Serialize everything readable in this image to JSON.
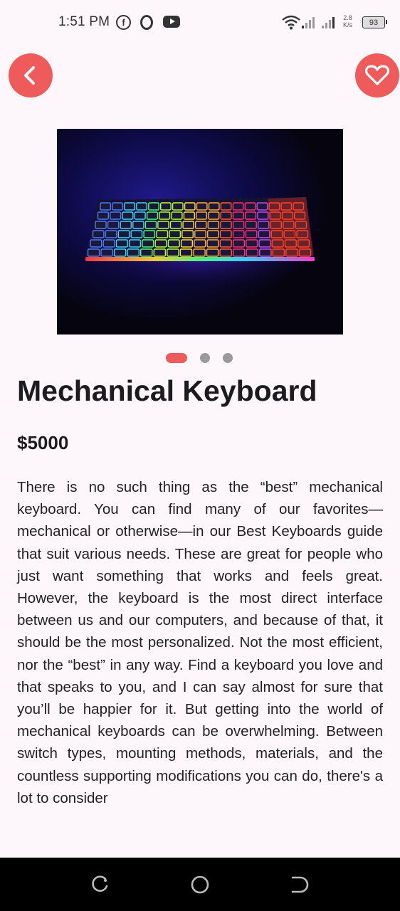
{
  "status_bar": {
    "time": "1:51 PM",
    "network_speed_value": "2.8",
    "network_speed_unit": "K/s",
    "battery": "93",
    "icons": [
      "facebook-icon",
      "opera-icon",
      "youtube-icon",
      "wifi-icon",
      "signal-icon",
      "battery-icon"
    ]
  },
  "header": {
    "back_icon": "chevron-left-icon",
    "favorite_icon": "heart-outline-icon",
    "accent_color": "#ef5b5b"
  },
  "carousel": {
    "image": "rgb-mechanical-keyboard-photo",
    "active_index": 0,
    "count": 3
  },
  "product": {
    "title": "Mechanical Keyboard",
    "price": "$5000",
    "description": "There is no such thing as the “best” mechanical keyboard. You can find many of our favorites—mechanical or otherwise—in our Best Keyboards guide that suit various needs. These are great for people who just want something that works and feels great. However, the keyboard is the most direct interface between us and our computers, and because of that, it should be the most personalized. Not the most efficient, nor the “best” in any way. Find a keyboard you love and that speaks to you, and I can say almost for sure that you’ll be happier for it. But getting into the world of mechanical keyboards can be overwhelming. Between switch types, mounting methods, materials, and the countless supporting modifications you can do, there's a lot to consider"
  },
  "nav_bar": {
    "icons": [
      "recent-apps-icon",
      "home-icon",
      "back-icon"
    ]
  }
}
